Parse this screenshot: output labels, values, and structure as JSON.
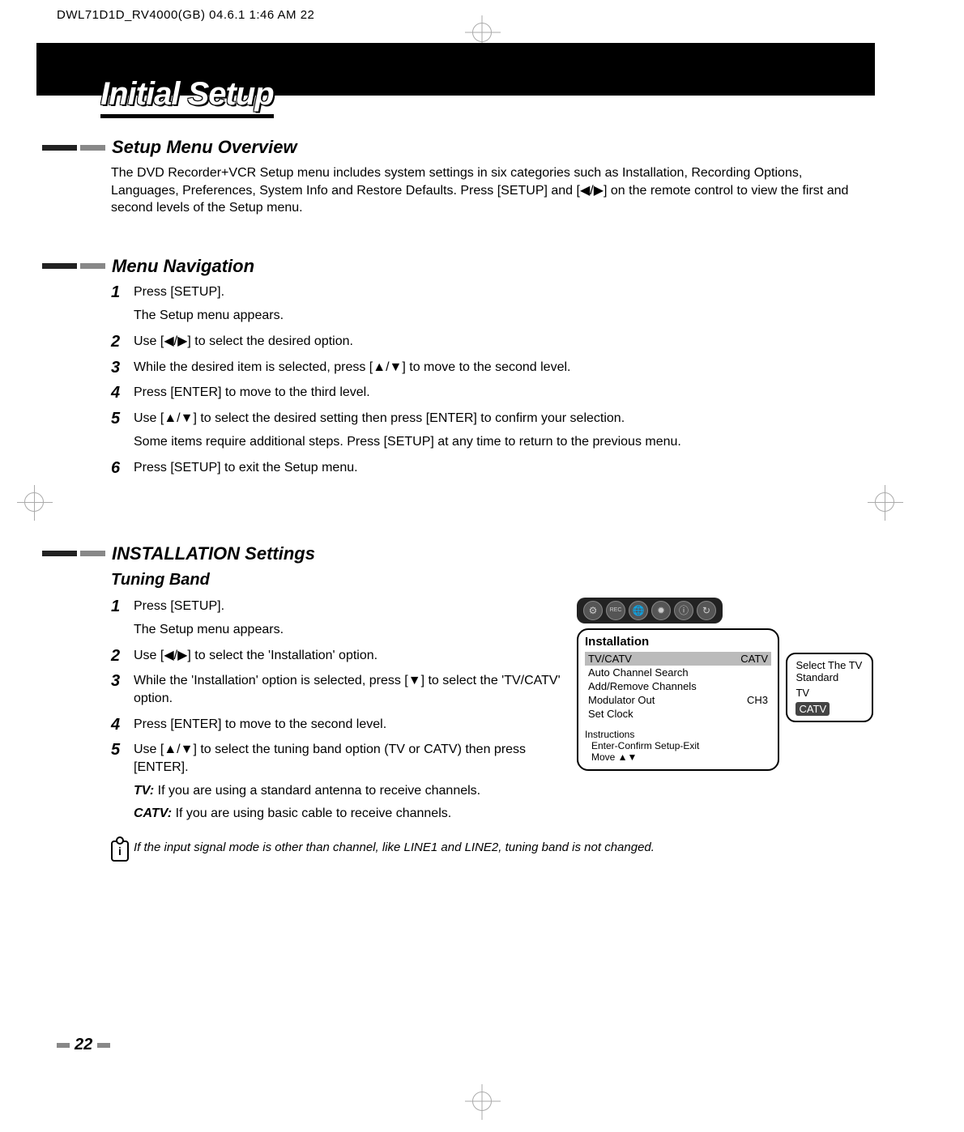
{
  "doc_header": "DWL71D1D_RV4000(GB)  04.6.1 1:46 AM      22",
  "page_title": "Initial Setup",
  "section1": {
    "heading": "Setup Menu Overview",
    "text": "The DVD Recorder+VCR Setup menu includes system settings in six categories such as Installation, Recording Options, Languages, Preferences, System Info and Restore Defaults. Press [SETUP] and [◀/▶] on the remote control to view the first and second levels of the Setup menu."
  },
  "section2": {
    "heading": "Menu Navigation",
    "steps": {
      "s1a": "Press [SETUP].",
      "s1b": "The Setup menu appears.",
      "s2": "Use [◀/▶] to select the desired option.",
      "s3": "While the desired item is selected, press [▲/▼] to move to the second level.",
      "s4": "Press [ENTER] to move to the third level.",
      "s5a": "Use [▲/▼] to select the desired setting then press [ENTER] to confirm your selection.",
      "s5b": "Some items require additional steps. Press [SETUP] at any time to return to the previous menu.",
      "s6": "Press [SETUP] to exit the Setup menu."
    }
  },
  "section3": {
    "heading": "INSTALLATION Settings",
    "subhead": "Tuning Band",
    "steps": {
      "s1a": "Press [SETUP].",
      "s1b": "The Setup menu appears.",
      "s2": "Use [◀/▶] to select the 'Installation' option.",
      "s3": "While the 'Installation' option is selected, press [▼] to select the 'TV/CATV' option.",
      "s4": "Press [ENTER] to move to the second level.",
      "s5": "Use [▲/▼] to select the tuning band option (TV or CATV) then press [ENTER].",
      "tv_label": "TV:",
      "tv_text": "If you are using a standard antenna to receive channels.",
      "catv_label": "CATV:",
      "catv_text": "If you are using basic cable to receive channels."
    },
    "note": "If the input signal mode is other than channel, like LINE1 and LINE2, tuning band is not changed."
  },
  "osd": {
    "title": "Installation",
    "rows": {
      "r1_label": "TV/CATV",
      "r1_value": "CATV",
      "r2_label": "Auto Channel Search",
      "r3_label": "Add/Remove Channels",
      "r4_label": "Modulator Out",
      "r4_value": "CH3",
      "r5_label": "Set Clock"
    },
    "instructions_label": "Instructions",
    "inst_line1": "Enter-Confirm   Setup-Exit",
    "inst_line2": "Move ▲▼",
    "popup": {
      "line1": "Select The TV",
      "line2": "Standard",
      "opt1": "TV",
      "opt2": "CATV"
    }
  },
  "page_number": "22",
  "note_icon_text": "i"
}
